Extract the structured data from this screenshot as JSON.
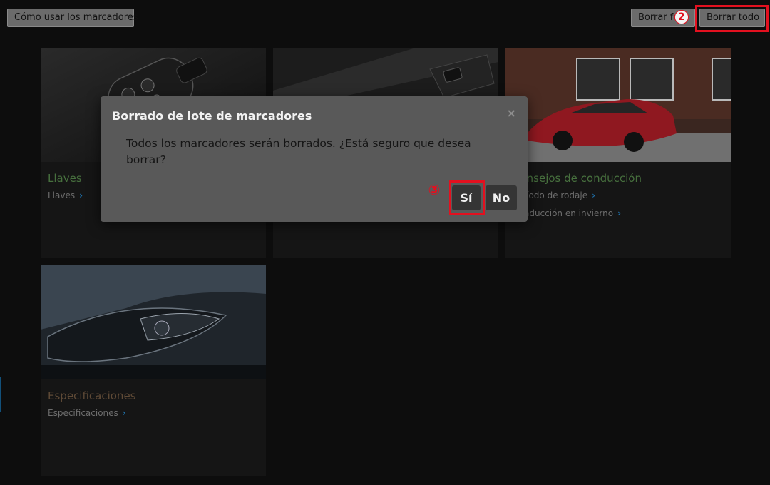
{
  "toolbar": {
    "howto_label": "Cómo usar los marcadores",
    "delete_date_label": "Borrar fe",
    "delete_all_label": "Borrar todo"
  },
  "annotations": {
    "marker2": "2",
    "marker3": "③"
  },
  "cards": [
    {
      "title": "Llaves",
      "links": [
        "Llaves"
      ]
    },
    {
      "title": "",
      "links": []
    },
    {
      "title": "Consejos de conducción",
      "links": [
        "Período de rodaje",
        "Conducción en invierno"
      ]
    },
    {
      "title": "Especificaciones",
      "links": [
        "Especificaciones"
      ]
    }
  ],
  "dialog": {
    "title": "Borrado de lote de marcadores",
    "close_icon": "×",
    "message": "Todos los marcadores serán borrados. ¿Está seguro que desea borrar?",
    "yes_label": "Sí",
    "no_label": "No"
  },
  "colors": {
    "highlight": "#e3101f",
    "card_title": "#47703e",
    "chevron": "#1e6fa8"
  },
  "icons": {
    "chevron": "chevron-right-icon",
    "close": "close-icon"
  }
}
